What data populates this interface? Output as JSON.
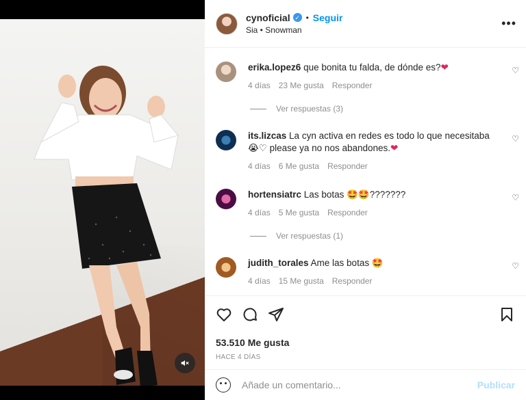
{
  "header": {
    "username": "cynoficial",
    "separator": "•",
    "follow_label": "Seguir",
    "audio": "Sia • Snowman"
  },
  "comments": [
    {
      "username": "erika.lopez6",
      "text": "que bonita tu falda, de dónde es?",
      "emoji": "❤",
      "time": "4 días",
      "likes": "23 Me gusta",
      "reply": "Responder",
      "view_replies": "Ver respuestas (3)",
      "avatar_color": "#c9b8a8"
    },
    {
      "username": "its.lizcas",
      "text_line1": "La cyn activa en redes es todo lo que necesitaba",
      "text_line2": "😭♡ please ya no nos abandones.",
      "emoji": "❤",
      "time": "4 días",
      "likes": "6 Me gusta",
      "reply": "Responder",
      "avatar_color": "#1f4d7a"
    },
    {
      "username": "hortensiatrc",
      "text": "Las botas 🤩🤩???????",
      "time": "4 días",
      "likes": "5 Me gusta",
      "reply": "Responder",
      "view_replies": "Ver respuestas (1)",
      "avatar_color": "#6a1a5e"
    },
    {
      "username": "judith_torales",
      "text": "Ame las botas 🤩",
      "time": "4 días",
      "likes": "15 Me gusta",
      "reply": "Responder",
      "avatar_color": "#c98a3a"
    }
  ],
  "likes_count": "53.510 Me gusta",
  "post_date": "HACE 4 DÍAS",
  "add_comment": {
    "placeholder": "Añade un comentario...",
    "publish_label": "Publicar"
  },
  "colors": {
    "accent": "#0095f6",
    "publish_disabled": "#b2dffc",
    "meta_gray": "#8e8e8e",
    "heart_red": "#e0245e"
  },
  "icons": {
    "like": "heart-icon",
    "comment": "comment-icon",
    "share": "paper-plane-icon",
    "save": "bookmark-icon",
    "mute": "muted-speaker-icon",
    "more": "more-options-icon",
    "emoji": "emoji-icon"
  }
}
